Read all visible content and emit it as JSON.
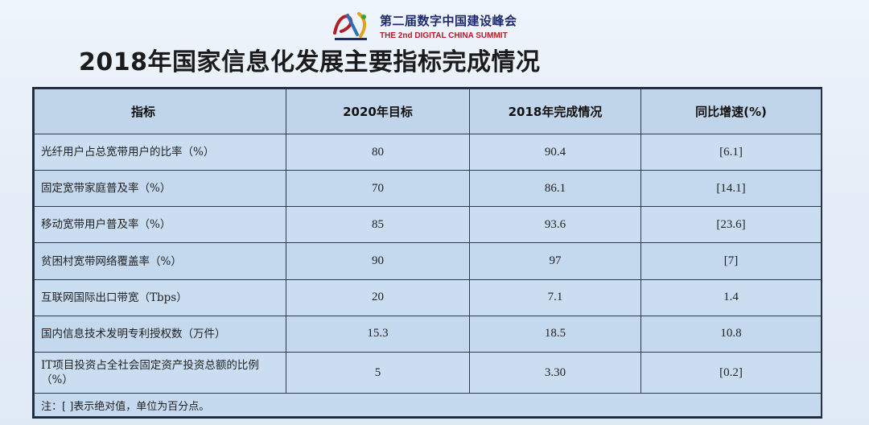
{
  "header": {
    "logo_cn": "第二届数字中国建设峰会",
    "logo_en": "THE 2nd DIGITAL CHINA SUMMIT"
  },
  "title": "2018年国家信息化发展主要指标完成情况",
  "table": {
    "columns": [
      "指标",
      "2020年目标",
      "2018年完成情况",
      "同比增速(%)"
    ],
    "rows": [
      {
        "indicator": "光纤用户占总宽带用户的比率（%）",
        "target_2020": "80",
        "actual_2018": "90.4",
        "yoy_growth": "[6.1]"
      },
      {
        "indicator": "固定宽带家庭普及率（%）",
        "target_2020": "70",
        "actual_2018": "86.1",
        "yoy_growth": "[14.1]"
      },
      {
        "indicator": "移动宽带用户普及率（%）",
        "target_2020": "85",
        "actual_2018": "93.6",
        "yoy_growth": "[23.6]"
      },
      {
        "indicator": "贫困村宽带网络覆盖率（%）",
        "target_2020": "90",
        "actual_2018": "97",
        "yoy_growth": "[7]"
      },
      {
        "indicator": "互联网国际出口带宽（Tbps）",
        "target_2020": "20",
        "actual_2018": "7.1",
        "yoy_growth": "1.4"
      },
      {
        "indicator": "国内信息技术发明专利授权数（万件）",
        "target_2020": "15.3",
        "actual_2018": "18.5",
        "yoy_growth": "10.8"
      },
      {
        "indicator": "IT项目投资占全社会固定资产投资总额的比例（%）",
        "target_2020": "5",
        "actual_2018": "3.30",
        "yoy_growth": "[0.2]"
      }
    ],
    "note": "注：[ ]表示绝对值，单位为百分点。"
  },
  "colors": {
    "logo_red": "#b51c2a",
    "logo_navy": "#1f2a6b",
    "table_bg": "#c9dcef",
    "grid_line": "#2a3a4c"
  }
}
